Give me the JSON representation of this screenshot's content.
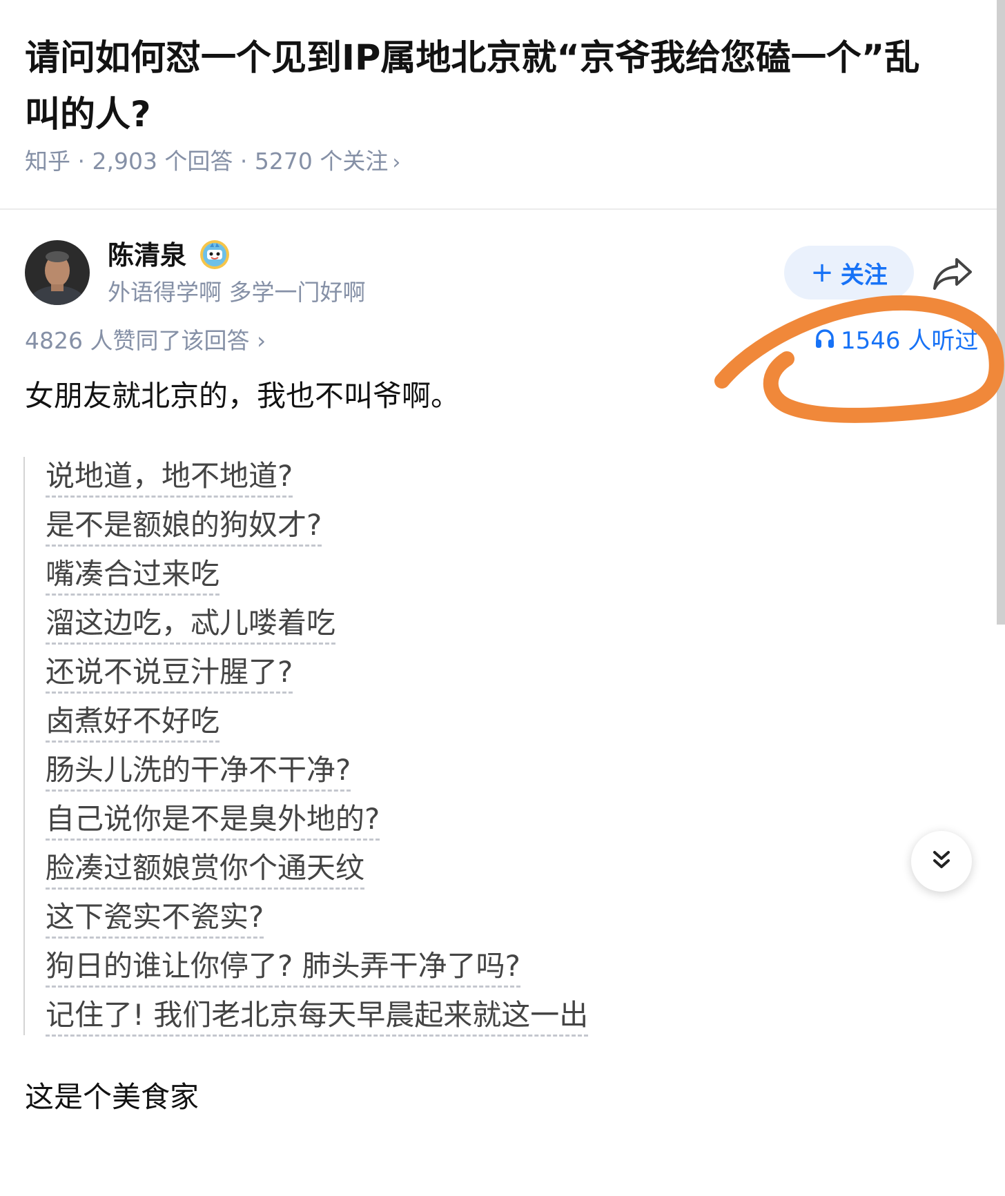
{
  "question": {
    "title": "请问如何怼一个见到IP属地北京就“京爷我给您磕一个”乱叫的人?",
    "meta": "知乎 · 2,903 个回答 · 5270 个关注",
    "meta_chevron": "›"
  },
  "author": {
    "name": "陈清泉",
    "bio": "外语得学啊 多学一门好啊",
    "badge_icon": "cartoon-badge-icon"
  },
  "actions": {
    "follow_plus": "+",
    "follow_label": "关注",
    "share_icon": "share-arrow-icon"
  },
  "stats": {
    "likes_text": "4826 人赞同了该回答 ›",
    "listen_count_text": "1546 人听过",
    "listen_icon": "headphones-icon"
  },
  "answer": {
    "lead": "女朋友就北京的，我也不叫爷啊。",
    "quote_lines": [
      "说地道，地不地道?",
      "是不是额娘的狗奴才?",
      "嘴凑合过来吃",
      "溜这边吃，忒儿喽着吃",
      "还说不说豆汁腥了?",
      "卤煮好不好吃",
      "肠头儿洗的干净不干净?",
      "自己说你是不是臭外地的?",
      "脸凑过额娘赏你个通天纹",
      "这下瓷实不瓷实?",
      "狗日的谁让你停了? 肺头弄干净了吗?",
      "记住了! 我们老北京每天早晨起来就这一出"
    ],
    "tail": "这是个美食家"
  },
  "floating_button_icon": "double-chevron-down-icon",
  "colors": {
    "accent_blue": "#1772f6",
    "muted_gray": "#8590a6",
    "annotation_orange": "#f0883a"
  }
}
